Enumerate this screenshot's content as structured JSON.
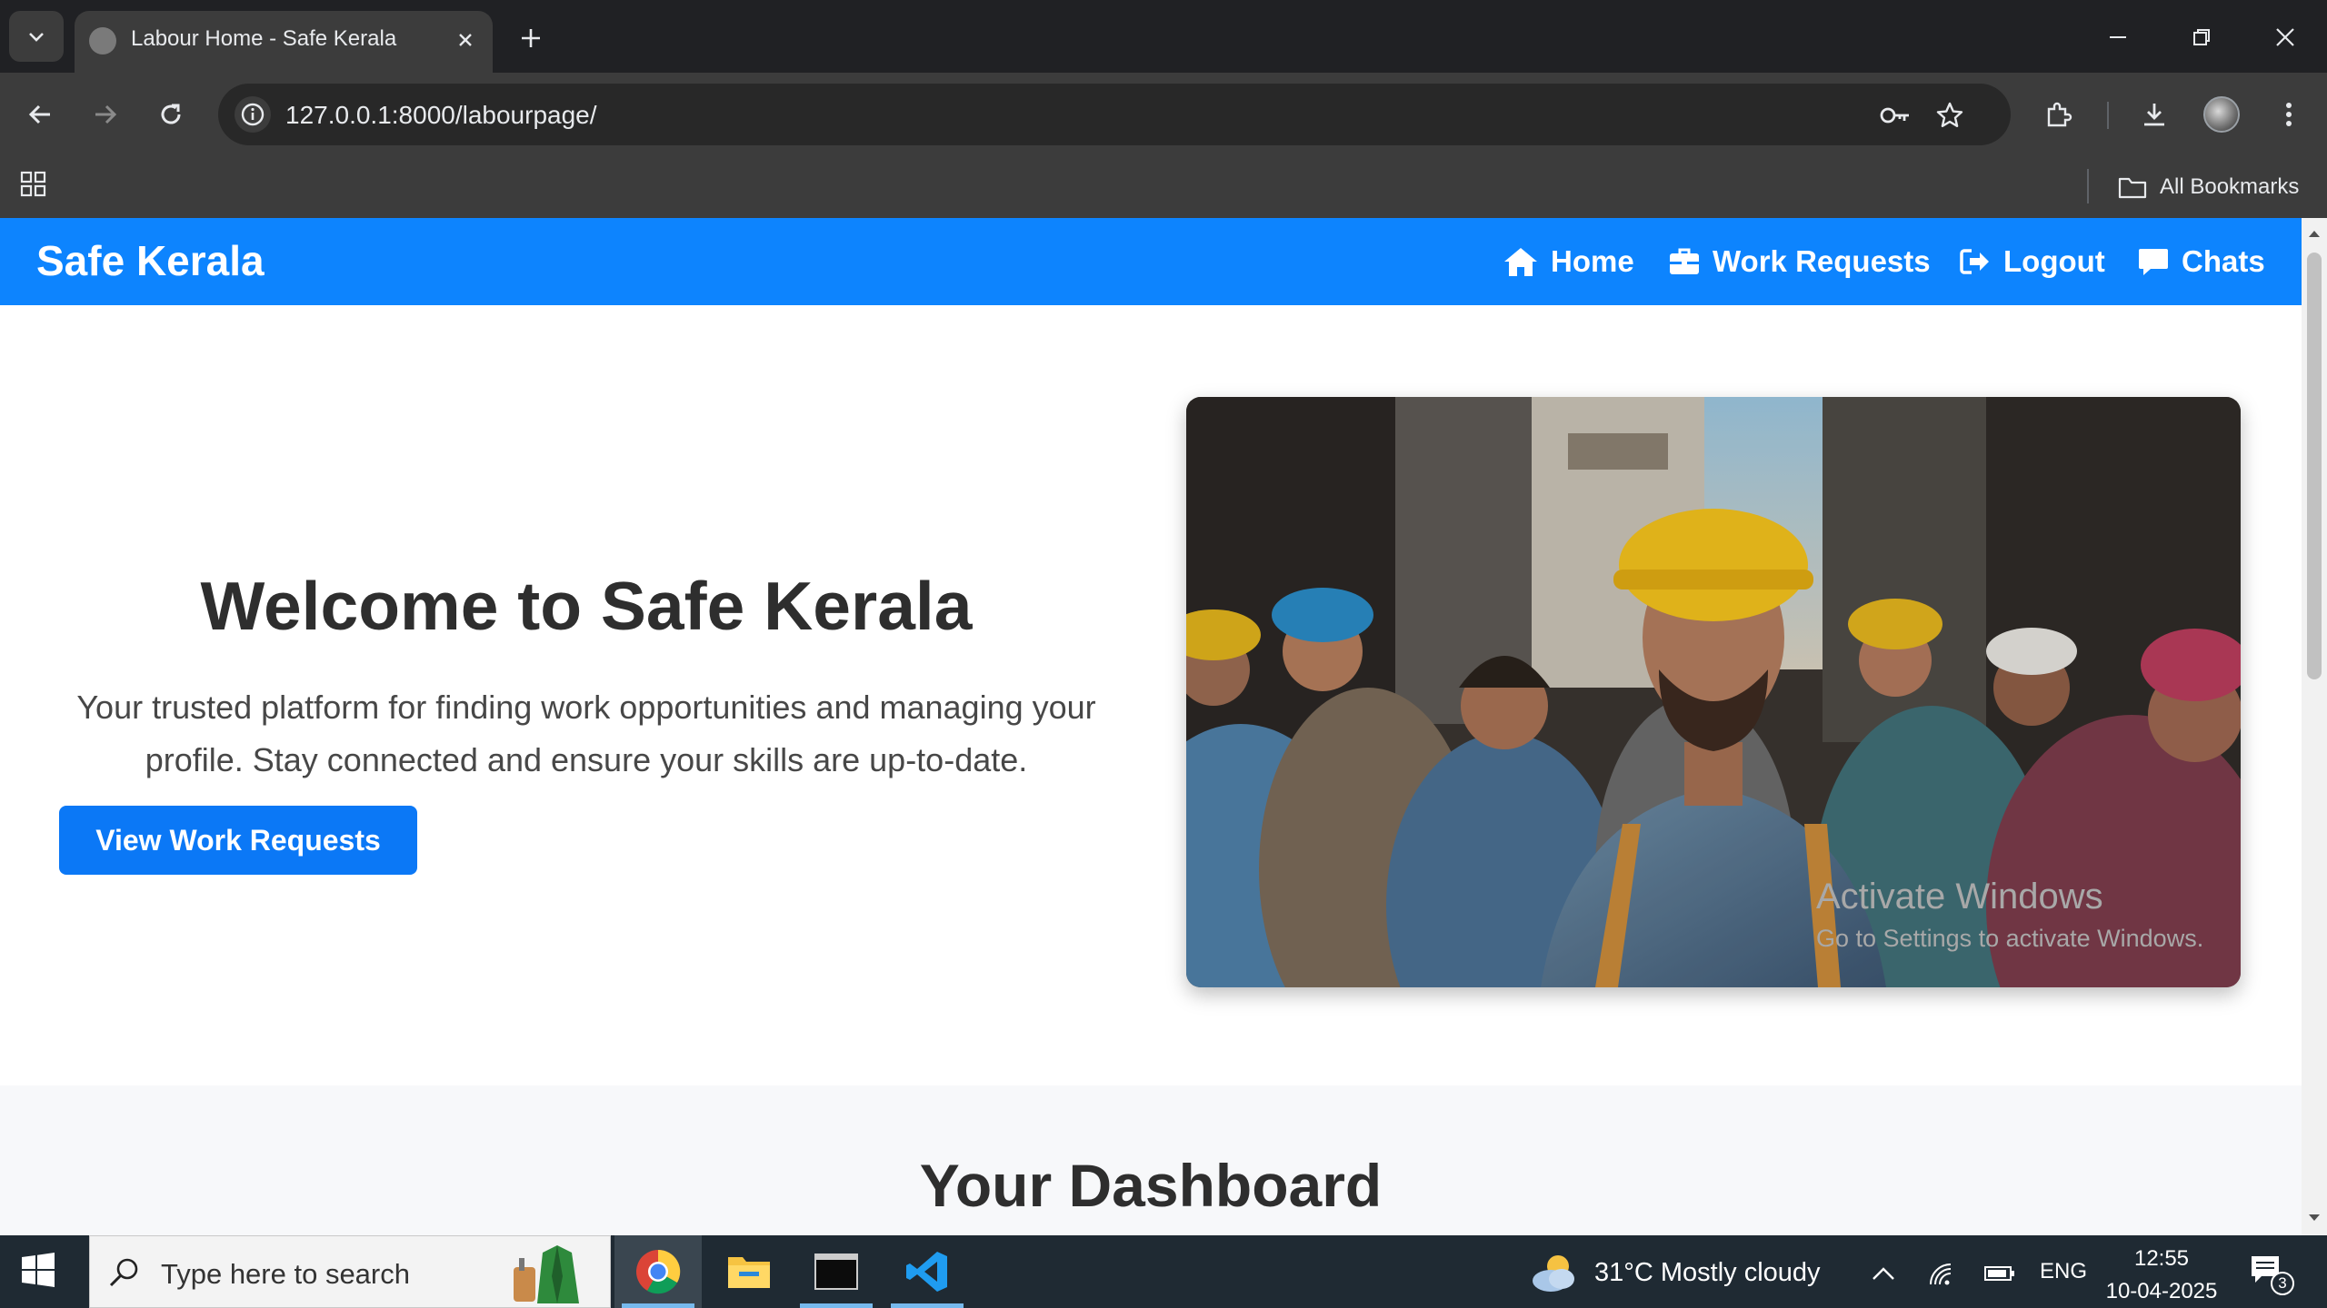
{
  "browser": {
    "tab_title": "Labour Home - Safe Kerala",
    "url": "127.0.0.1:8000/labourpage/",
    "bookmarks_label": "All Bookmarks"
  },
  "navbar": {
    "brand": "Safe Kerala",
    "items": [
      {
        "label": "Home",
        "icon": "home-icon"
      },
      {
        "label": "Work Requests",
        "icon": "briefcase-icon"
      },
      {
        "label": "Logout",
        "icon": "sign-out-icon"
      },
      {
        "label": "Chats",
        "icon": "comment-icon"
      }
    ]
  },
  "hero": {
    "title": "Welcome to Safe Kerala",
    "text": "Your trusted platform for finding work opportunities and managing your profile. Stay connected and ensure your skills are up-to-date.",
    "button": "View Work Requests",
    "image": "photo of construction workers in hard hats on a city street"
  },
  "dashboard": {
    "title": "Your Dashboard"
  },
  "watermark": {
    "line1": "Activate Windows",
    "line2": "Go to Settings to activate Windows."
  },
  "taskbar": {
    "search_placeholder": "Type here to search",
    "apps": [
      "chrome-icon",
      "file-explorer-icon",
      "terminal-icon",
      "vscode-icon"
    ],
    "weather": "31°C  Mostly cloudy",
    "language": "ENG",
    "time": "12:55",
    "date": "10-04-2025",
    "notification_count": "3"
  },
  "colors": {
    "navbar": "#0d84fe",
    "button": "#0b78f6",
    "browser_frame": "#202124",
    "toolbar": "#3c3c3c",
    "taskbar": "#1f2a33"
  }
}
